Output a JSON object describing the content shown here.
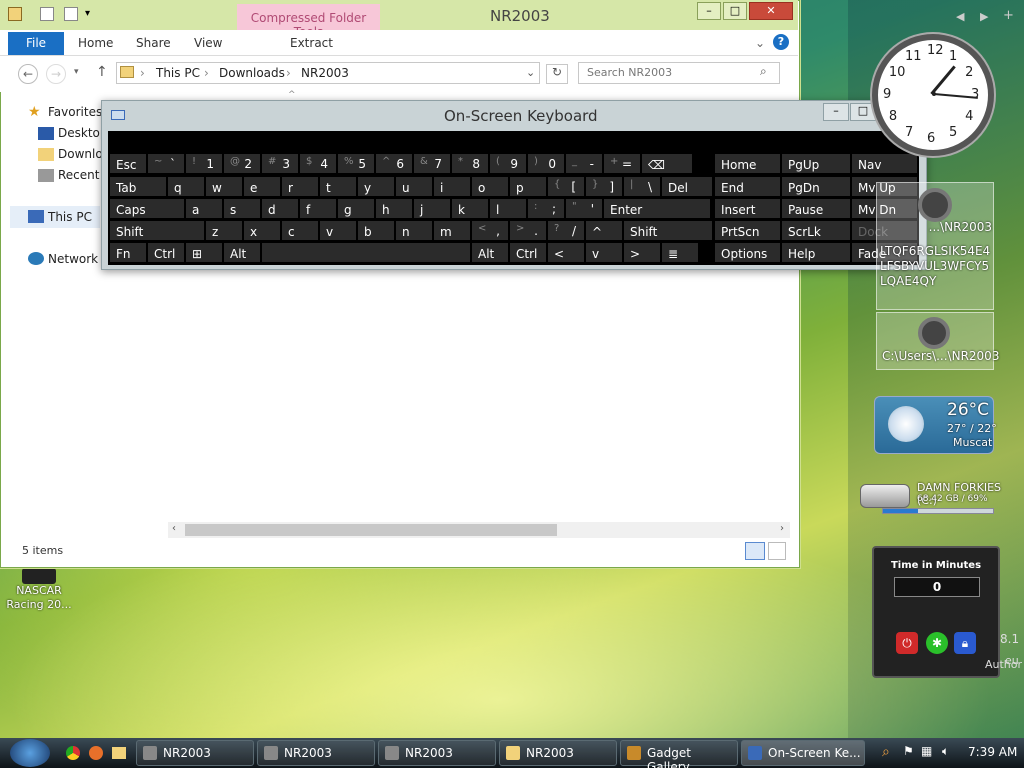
{
  "explorer": {
    "title": "NR2003",
    "context_tab": "Compressed Folder Tools",
    "ribbon_tabs": [
      "File",
      "Home",
      "Share",
      "View",
      "Extract"
    ],
    "breadcrumb": [
      "This PC",
      "Downloads",
      "NR2003"
    ],
    "search_placeholder": "Search NR2003",
    "nav": [
      "Favorites",
      "Desktop",
      "Downlo",
      "Recent",
      "This PC",
      "Network"
    ],
    "status": "5 items"
  },
  "osk": {
    "title": "On-Screen Keyboard",
    "rows": [
      [
        {
          "l": "Esc"
        },
        {
          "s": "~",
          "m": "`"
        },
        {
          "s": "!",
          "m": "1"
        },
        {
          "s": "@",
          "m": "2"
        },
        {
          "s": "#",
          "m": "3"
        },
        {
          "s": "$",
          "m": "4"
        },
        {
          "s": "%",
          "m": "5"
        },
        {
          "s": "^",
          "m": "6"
        },
        {
          "s": "&",
          "m": "7"
        },
        {
          "s": "*",
          "m": "8"
        },
        {
          "s": "(",
          "m": "9"
        },
        {
          "s": ")",
          "m": "0"
        },
        {
          "s": "_",
          "m": "-"
        },
        {
          "s": "+",
          "m": "="
        },
        {
          "l": "⌫"
        }
      ],
      [
        {
          "l": "Tab"
        },
        {
          "l": "q"
        },
        {
          "l": "w"
        },
        {
          "l": "e"
        },
        {
          "l": "r"
        },
        {
          "l": "t"
        },
        {
          "l": "y"
        },
        {
          "l": "u"
        },
        {
          "l": "i"
        },
        {
          "l": "o"
        },
        {
          "l": "p"
        },
        {
          "s": "{",
          "m": "["
        },
        {
          "s": "}",
          "m": "]"
        },
        {
          "s": "|",
          "m": "\\"
        },
        {
          "l": "Del"
        }
      ],
      [
        {
          "l": "Caps"
        },
        {
          "l": "a"
        },
        {
          "l": "s"
        },
        {
          "l": "d"
        },
        {
          "l": "f"
        },
        {
          "l": "g"
        },
        {
          "l": "h"
        },
        {
          "l": "j"
        },
        {
          "l": "k"
        },
        {
          "l": "l"
        },
        {
          "s": ":",
          "m": ";"
        },
        {
          "s": "\"",
          "m": "'"
        },
        {
          "l": "Enter"
        }
      ],
      [
        {
          "l": "Shift"
        },
        {
          "l": "z"
        },
        {
          "l": "x"
        },
        {
          "l": "c"
        },
        {
          "l": "v"
        },
        {
          "l": "b"
        },
        {
          "l": "n"
        },
        {
          "l": "m"
        },
        {
          "s": "<",
          "m": ","
        },
        {
          "s": ">",
          "m": "."
        },
        {
          "s": "?",
          "m": "/"
        },
        {
          "l": "^"
        },
        {
          "l": "Shift"
        }
      ],
      [
        {
          "l": "Fn"
        },
        {
          "l": "Ctrl"
        },
        {
          "l": "⊞"
        },
        {
          "l": "Alt"
        },
        {
          "l": ""
        },
        {
          "l": "Alt"
        },
        {
          "l": "Ctrl"
        },
        {
          "l": "<"
        },
        {
          "l": "v"
        },
        {
          "l": ">"
        },
        {
          "l": "≣"
        }
      ]
    ],
    "right": [
      [
        "Home",
        "PgUp",
        "Nav"
      ],
      [
        "End",
        "PgDn",
        "Mv Up"
      ],
      [
        "Insert",
        "Pause",
        "Mv Dn"
      ],
      [
        "PrtScn",
        "ScrLk",
        "Dock"
      ],
      [
        "Options",
        "Help",
        "Fade"
      ]
    ]
  },
  "gadgets": {
    "clock_numbers": [
      "12",
      "1",
      "2",
      "3",
      "4",
      "5",
      "6",
      "7",
      "8",
      "9",
      "10",
      "11"
    ],
    "slideshow": [
      "...\\NR2003",
      "LTQF6RGLSIK54E4LFSBYVUL3WFCY5LQAE4QY",
      "C:\\Users\\...\\NR2003"
    ],
    "weather": {
      "temp": "26°C",
      "range": "27° / 22°",
      "city": "Muscat"
    },
    "drive": {
      "name": "DAMN FORKIES (C:)",
      "info": "68.42 GB / 69%"
    },
    "timer": {
      "title": "Time in Minutes",
      "value": "0",
      "side": "8.1",
      "author": "Author",
      "eu": "eu"
    }
  },
  "desktop_icon": {
    "label": "NASCAR Racing 20..."
  },
  "taskbar": {
    "items": [
      "NR2003",
      "NR2003",
      "NR2003",
      "NR2003",
      "Gadget Gallery",
      "On-Screen Ke..."
    ],
    "time": "7:39 AM"
  }
}
